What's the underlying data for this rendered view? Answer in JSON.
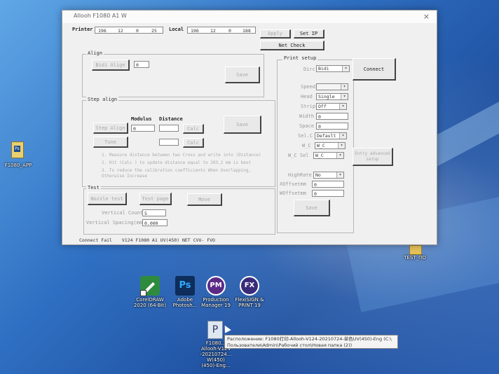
{
  "window": {
    "title": "Allooh F1080 A1 W",
    "close": "×"
  },
  "network": {
    "printer_label": "Printer",
    "printer_ip": [
      "196",
      "12",
      "0",
      "25"
    ],
    "local_label": "Local",
    "local_ip": [
      "196",
      "12",
      "0",
      "188"
    ],
    "apply_label": "Apply",
    "set_ip_label": "Set IP",
    "net_check_label": "Net Check"
  },
  "align": {
    "group_title": "Align",
    "bidi_align_label": "Bidi Align",
    "bidi_value": "0",
    "save_label": "Save"
  },
  "step_align": {
    "group_title": "Step align",
    "modulus_label": "Modulus",
    "distance_label": "Distance",
    "step_align_label": "Step Align",
    "modulus_value": "0",
    "calc_label": "Calc",
    "save_label": "Save",
    "tune_label": "Tune",
    "notes": [
      "1. Measure distance between two Cross and write into (Distance)",
      "2. Hit (Calc ) to update distance equal to 203.2 mm is best",
      "3. To reduce the calibration coefficients When Overlapping,",
      "Otherwise Increase"
    ]
  },
  "test": {
    "group_title": "Test",
    "nozzle_test_label": "Nozzle test",
    "test_page_label": "Test page",
    "move_label": "Move",
    "vertical_count_label": "Vertical Count",
    "vertical_count_value": "5",
    "vertical_spacing_label": "Vertical Spacing(mm)",
    "vertical_spacing_value": "0.000"
  },
  "print_setup": {
    "group_title": "Print setup",
    "dirc_label": "Dirc",
    "dirc_value": "Bidi",
    "connect_label": "Connect",
    "speed_label": "Speed",
    "head_label": "Head",
    "head_value": "Single",
    "strip_label": "Strip",
    "strip_value": "Off",
    "width_label": "Width",
    "width_value": "0",
    "space_label": "Space",
    "space_value": "0",
    "sel_label": "Sel.C",
    "sel_value": "Default",
    "wc_label": "W_C",
    "wc_value": "W_C",
    "wcsel_label": "W_C Sel",
    "wcsel_value": "W_C",
    "entry_advanced_label": "Entry advanced setup",
    "highrate_label": "HighRate",
    "highrate_value": "No",
    "xoffset_label": "XOffsetmm",
    "xoffset_value": "0",
    "woffset_label": "WOffsetmm",
    "woffset_value": "0",
    "save_label": "Save"
  },
  "status": {
    "connection": "Connect Fail",
    "version": "V124 F1080 A1 UV(450) NET  CVU- FVO"
  },
  "desktop_icons": {
    "left_file": "F1080_APP",
    "right_file": "TEST_ПО",
    "coreldraw": [
      "CorelDRAW",
      "2020 (64-Bit)"
    ],
    "photoshop": [
      "Adobe",
      "Photosh..."
    ],
    "production_manager": [
      "Production",
      "Manager 19"
    ],
    "flexi": [
      "FlexiSIGN &",
      "PRINT 19"
    ],
    "app_shortcut": [
      "F1080...",
      "Allooh-V124",
      "-20210724...",
      "W(450)",
      "(450)-Eng..."
    ]
  },
  "tooltip": {
    "line1": "Расположение: F1080打印-Allooh-V124-20210724-单色UV(450)-Eng (C:\\",
    "line2": "Пользователи\\Admin\\Рабочий стол\\Новая папка (2))"
  },
  "colors": {
    "desktop_blue": "#2f6fc2",
    "window_bg": "#f0f0f0",
    "corel_green": "#2e8b3e",
    "ps_blue": "#0e2d5a",
    "pm_purple": "#5b2a86",
    "fx_purple": "#3a2a7a"
  }
}
